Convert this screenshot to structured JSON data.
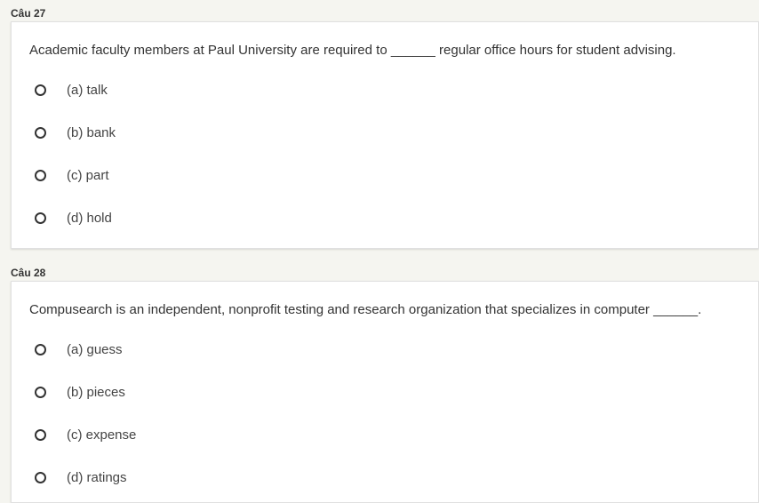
{
  "questions": [
    {
      "header": "Câu 27",
      "text": "Academic faculty members at Paul University are required to ______ regular office hours for student advising.",
      "options": [
        "(a) talk",
        "(b) bank",
        "(c) part",
        "(d) hold"
      ]
    },
    {
      "header": "Câu 28",
      "text": "Compusearch is an independent, nonprofit testing and research organization that specializes in computer ______.",
      "options": [
        "(a) guess",
        "(b) pieces",
        "(c) expense",
        "(d) ratings"
      ]
    }
  ],
  "colors": {
    "background": "#f5f5f0",
    "card": "#ffffff",
    "text": "#333333"
  },
  "icons": {
    "option_radio": "radio-unchecked-icon"
  }
}
